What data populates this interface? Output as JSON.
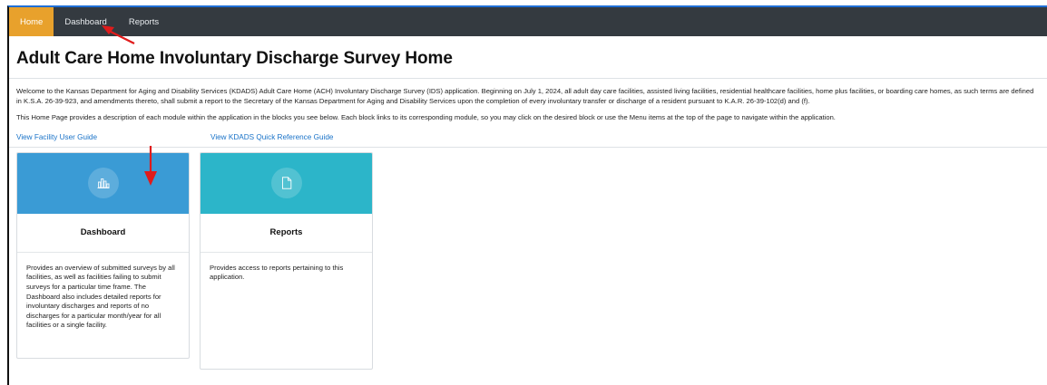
{
  "nav": {
    "items": [
      {
        "label": "Home",
        "active": true
      },
      {
        "label": "Dashboard",
        "active": false
      },
      {
        "label": "Reports",
        "active": false
      }
    ],
    "active_color": "#e8a12c",
    "bg_color": "#343a40"
  },
  "page": {
    "title": "Adult Care Home Involuntary Discharge Survey Home",
    "intro": "Welcome to the Kansas Department for Aging and Disability Services (KDADS) Adult Care Home (ACH) Involuntary Discharge Survey (IDS) application. Beginning on July 1, 2024, all adult day care facilities, assisted living facilities, residential healthcare facilities, home plus facilities, or boarding care homes, as such terms are defined in K.S.A. 26-39-923, and amendments thereto, shall submit a report to the Secretary of the Kansas Department for Aging and Disability Services upon the completion of every involuntary transfer or discharge of a resident pursuant to K.A.R. 26-39-102(d) and (f).",
    "intro2": "This Home Page provides a description of each module within the application in the blocks you see below. Each block links to its corresponding module, so you may click on the desired block or use the Menu items at the top of the page to navigate within the application."
  },
  "links": {
    "facility_guide": "View Facility User Guide",
    "quick_reference": "View KDADS Quick Reference Guide"
  },
  "cards": [
    {
      "title": "Dashboard",
      "icon": "bar-chart-icon",
      "color": "#3a9bd5",
      "description": "Provides an overview of submitted surveys by all facilities, as well as facilities failing to submit surveys for a particular time frame. The Dashboard also includes detailed reports for involuntary discharges and reports of no discharges for a particular month/year for all facilities or a single facility."
    },
    {
      "title": "Reports",
      "icon": "document-icon",
      "color": "#2cb5c9",
      "description": "Provides access to reports pertaining to this application."
    }
  ],
  "annotation_color": "#e01b1b"
}
